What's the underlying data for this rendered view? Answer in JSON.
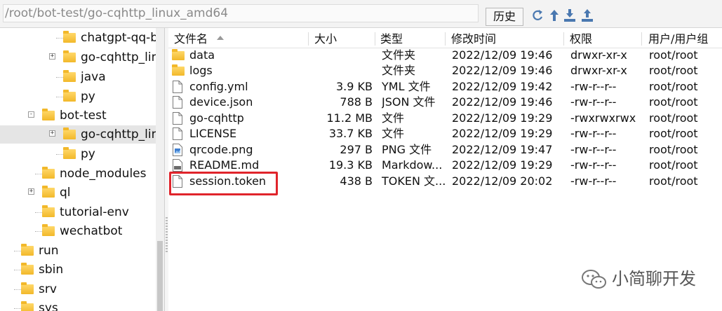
{
  "pathbar": {
    "path": "/root/bot-test/go-cqhttp_linux_amd64",
    "history_label": "历史"
  },
  "toolbar_icons": [
    "refresh-icon",
    "up-arrow-icon",
    "download-icon",
    "upload-icon"
  ],
  "tree": {
    "items": [
      {
        "label": "chatgpt-qq-bo",
        "expander": ""
      },
      {
        "label": "go-cqhttp_linu",
        "expander": "+"
      },
      {
        "label": "java",
        "expander": ""
      },
      {
        "label": "py",
        "expander": ""
      },
      {
        "label": "bot-test",
        "expander": "-"
      },
      {
        "label": "go-cqhttp_linu",
        "expander": "+",
        "selected": true
      },
      {
        "label": "py",
        "expander": ""
      },
      {
        "label": "node_modules",
        "expander": ""
      },
      {
        "label": "ql",
        "expander": "+"
      },
      {
        "label": "tutorial-env",
        "expander": ""
      },
      {
        "label": "wechatbot",
        "expander": ""
      },
      {
        "label": "run",
        "expander": ""
      },
      {
        "label": "sbin",
        "expander": ""
      },
      {
        "label": "srv",
        "expander": ""
      },
      {
        "label": "sys",
        "expander": ""
      }
    ]
  },
  "columns": {
    "name": "文件名",
    "size": "大小",
    "type": "类型",
    "modified": "修改时间",
    "permissions": "权限",
    "owner": "用户/用户组"
  },
  "files": [
    {
      "name": "data",
      "size": "",
      "type": "文件夹",
      "modified": "2022/12/09 19:46",
      "permissions": "drwxr-xr-x",
      "owner": "root/root",
      "icon": "folder-icon"
    },
    {
      "name": "logs",
      "size": "",
      "type": "文件夹",
      "modified": "2022/12/09 19:46",
      "permissions": "drwxr-xr-x",
      "owner": "root/root",
      "icon": "folder-icon"
    },
    {
      "name": "config.yml",
      "size": "3.9 KB",
      "type": "YML 文件",
      "modified": "2022/12/09 19:42",
      "permissions": "-rw-r--r--",
      "owner": "root/root",
      "icon": "file-icon"
    },
    {
      "name": "device.json",
      "size": "788 B",
      "type": "JSON 文件",
      "modified": "2022/12/09 19:46",
      "permissions": "-rw-r--r--",
      "owner": "root/root",
      "icon": "file-icon"
    },
    {
      "name": "go-cqhttp",
      "size": "11.2 MB",
      "type": "文件",
      "modified": "2022/12/09 19:29",
      "permissions": "-rwxrwxrwx",
      "owner": "root/root",
      "icon": "file-icon"
    },
    {
      "name": "LICENSE",
      "size": "33.7 KB",
      "type": "文件",
      "modified": "2022/12/09 19:29",
      "permissions": "-rw-r--r--",
      "owner": "root/root",
      "icon": "file-icon"
    },
    {
      "name": "qrcode.png",
      "size": "297 B",
      "type": "PNG 文件",
      "modified": "2022/12/09 19:47",
      "permissions": "-rw-r--r--",
      "owner": "root/root",
      "icon": "image-file-icon"
    },
    {
      "name": "README.md",
      "size": "19.3 KB",
      "type": "Markdow...",
      "modified": "2022/12/09 19:29",
      "permissions": "-rw-r--r--",
      "owner": "root/root",
      "icon": "markdown-file-icon"
    },
    {
      "name": "session.token",
      "size": "438 B",
      "type": "TOKEN 文...",
      "modified": "2022/12/09 20:02",
      "permissions": "-rw-r--r--",
      "owner": "root/root",
      "icon": "file-icon",
      "highlighted": true
    }
  ],
  "watermark": {
    "text": "小简聊开发",
    "icon": "wechat-logo-icon"
  },
  "colors": {
    "highlight": "#e0242b",
    "folder": "#f2b82a",
    "selected_row": "#e5e5e5"
  }
}
